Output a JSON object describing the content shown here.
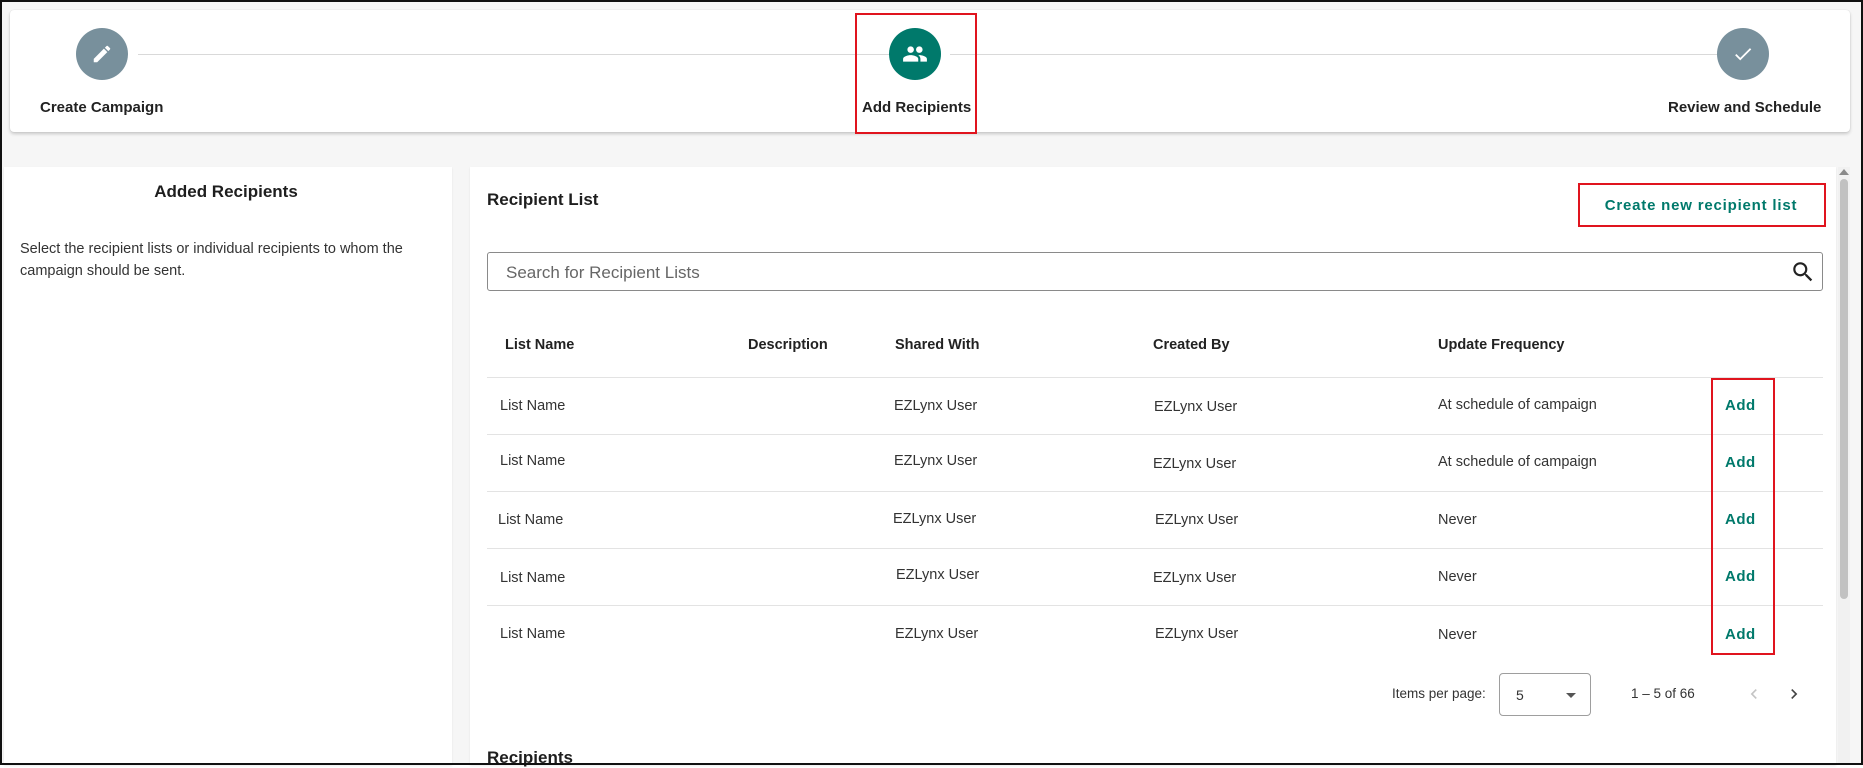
{
  "stepper": {
    "steps": [
      {
        "label": "Create Campaign",
        "icon": "pencil-icon",
        "state": "complete"
      },
      {
        "label": "Add Recipients",
        "icon": "people-icon",
        "state": "active"
      },
      {
        "label": "Review and Schedule",
        "icon": "check-icon",
        "state": "upcoming"
      }
    ]
  },
  "left_panel": {
    "title": "Added Recipients",
    "description": "Select the recipient lists or individual recipients to whom the campaign should be sent."
  },
  "recipient_list": {
    "title": "Recipient List",
    "create_button": "Create new recipient list",
    "search_placeholder": "Search for Recipient Lists",
    "columns": [
      "List Name",
      "Description",
      "Shared With",
      "Created By",
      "Update Frequency"
    ],
    "rows": [
      {
        "list_name": "List Name",
        "description": "",
        "shared_with": "EZLynx User",
        "created_by": "EZLynx User",
        "update_frequency": "At schedule of campaign",
        "action": "Add"
      },
      {
        "list_name": "List Name",
        "description": "",
        "shared_with": "EZLynx User",
        "created_by": "EZLynx User",
        "update_frequency": "At schedule of campaign",
        "action": "Add"
      },
      {
        "list_name": "List Name",
        "description": "",
        "shared_with": "EZLynx User",
        "created_by": "EZLynx User",
        "update_frequency": "Never",
        "action": "Add"
      },
      {
        "list_name": "List Name",
        "description": "",
        "shared_with": "EZLynx User",
        "created_by": "EZLynx User",
        "update_frequency": "Never",
        "action": "Add"
      },
      {
        "list_name": "List Name",
        "description": "",
        "shared_with": "EZLynx User",
        "created_by": "EZLynx User",
        "update_frequency": "Never",
        "action": "Add"
      }
    ],
    "pagination": {
      "items_per_page_label": "Items per page:",
      "items_per_page": "5",
      "range": "1 – 5 of 66"
    }
  },
  "recipients_section": {
    "title": "Recipients"
  },
  "colors": {
    "accent": "#00796b",
    "step_inactive": "#78909c",
    "highlight": "#e0141e"
  }
}
